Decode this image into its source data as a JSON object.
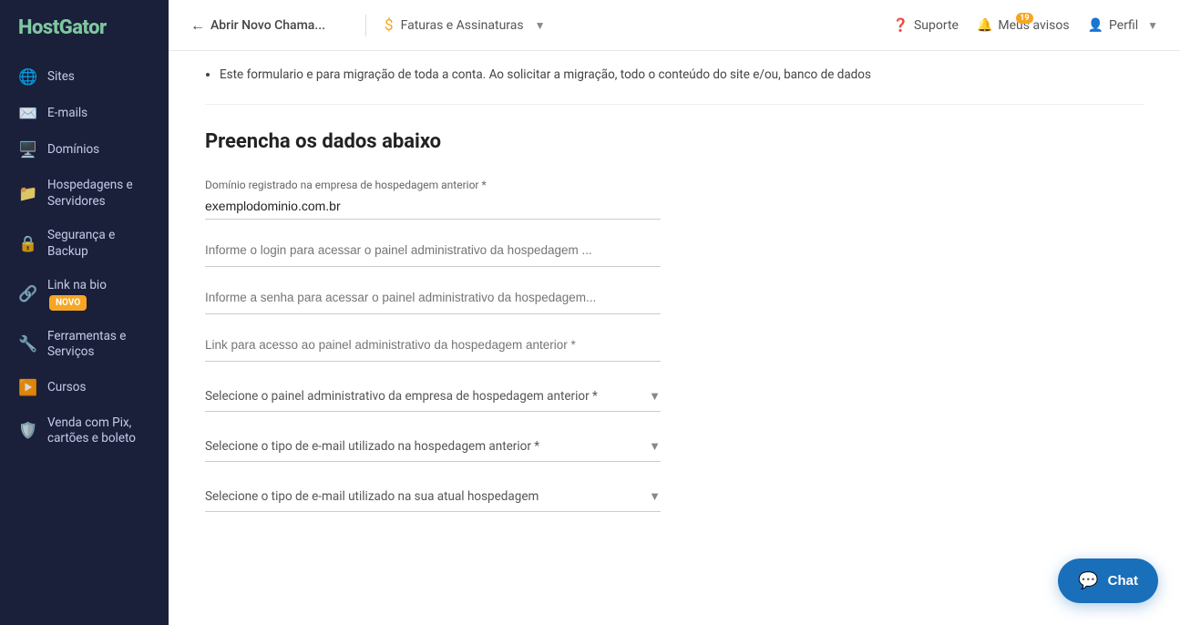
{
  "brand": {
    "name_part1": "Host",
    "name_part2": "Gator"
  },
  "sidebar": {
    "items": [
      {
        "id": "sites",
        "label": "Sites",
        "icon": "🌐"
      },
      {
        "id": "emails",
        "label": "E-mails",
        "icon": "✉️"
      },
      {
        "id": "dominios",
        "label": "Domínios",
        "icon": "🖥️"
      },
      {
        "id": "hospedagens",
        "label": "Hospedagens e\nServidores",
        "icon": "📁"
      },
      {
        "id": "seguranca",
        "label": "Segurança e Backup",
        "icon": "🔒"
      },
      {
        "id": "link-bio",
        "label": "Link na bio",
        "icon": "🔗",
        "badge": "NOVO"
      },
      {
        "id": "ferramentas",
        "label": "Ferramentas e Serviços",
        "icon": "🔧"
      },
      {
        "id": "cursos",
        "label": "Cursos",
        "icon": "▶️"
      },
      {
        "id": "venda-pix",
        "label": "Venda com Pix, cartões e boleto",
        "icon": "🛡️"
      }
    ]
  },
  "topbar": {
    "back_label": "Abrir Novo Chama...",
    "invoices_label": "Faturas e Assinaturas",
    "support_label": "Suporte",
    "notifications_label": "Meus avisos",
    "notifications_count": "19",
    "profile_label": "Perfil"
  },
  "content": {
    "note_text1": "Este formulario e para migração de toda a conta. Ao solicitar a migração,",
    "note_text2": "todo o conteúdo do site e/ou, banco de dados",
    "section_title": "Preencha os dados abaixo",
    "field_domain_label": "Domínio registrado na empresa de hospedagem anterior *",
    "field_domain_value": "exemplodominio.com.br",
    "field_login_placeholder": "Informe o login para acessar o painel administrativo da hospedagem ...",
    "field_password_placeholder": "Informe a senha para acessar o painel administrativo da hospedagem...",
    "field_link_placeholder": "Link para acesso ao painel administrativo da hospedagem anterior *",
    "select_panel_placeholder": "Selecione o painel administrativo da empresa de hospedagem anterior *",
    "select_email_type_placeholder": "Selecione o tipo de e-mail utilizado na hospedagem anterior *",
    "select_email_current_placeholder": "Selecione o tipo de e-mail utilizado na sua atual hospedagem"
  },
  "chat_button": {
    "label": "Chat",
    "icon": "💬"
  }
}
